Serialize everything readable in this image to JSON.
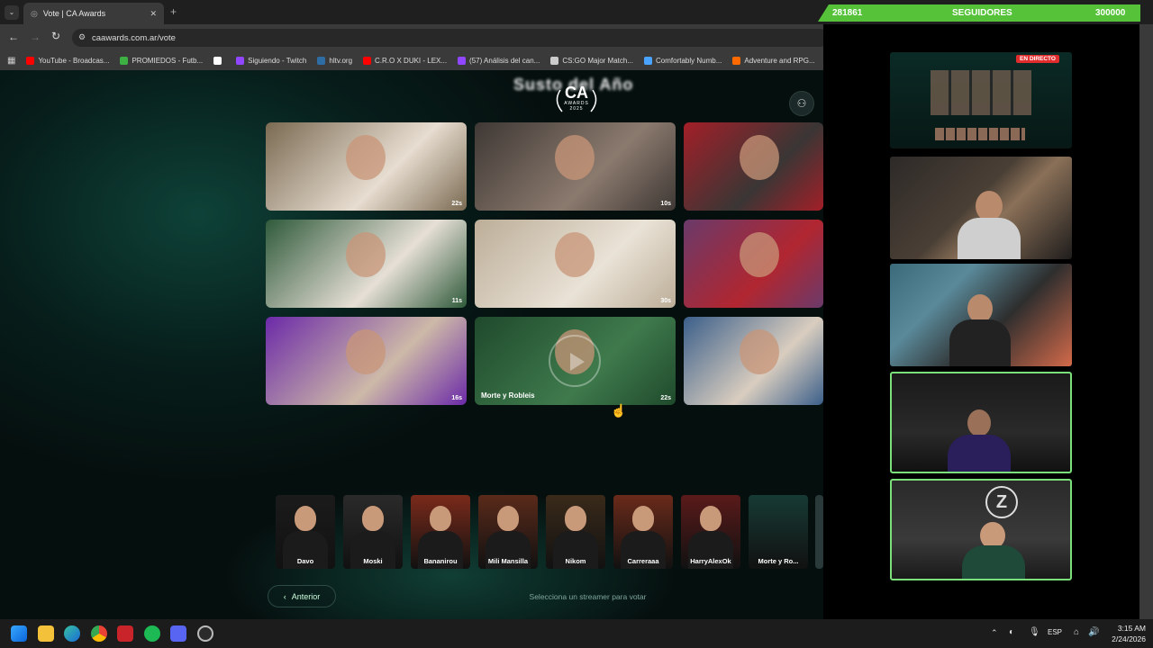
{
  "browser": {
    "tab_title": "Vote | CA Awards",
    "url": "caawards.com.ar/vote",
    "bookmarks": [
      {
        "label": "YouTube - Broadcas...",
        "icon": "youtube-icon",
        "color": "#ff0000"
      },
      {
        "label": "PROMIEDOS - Futb...",
        "icon": "promiedos-icon",
        "color": "#3cb043"
      },
      {
        "label": "",
        "icon": "x-icon",
        "color": "#ffffff"
      },
      {
        "label": "Siguiendo - Twitch",
        "icon": "twitch-icon",
        "color": "#9146ff"
      },
      {
        "label": "hltv.org",
        "icon": "hltv-icon",
        "color": "#2d6da3"
      },
      {
        "label": "C.R.O X DUKI - LEX...",
        "icon": "youtube-icon",
        "color": "#ff0000"
      },
      {
        "label": "(57) Análisis del can...",
        "icon": "twitch-icon",
        "color": "#9146ff"
      },
      {
        "label": "CS:GO Major Match...",
        "icon": "link-icon",
        "color": "#cccccc"
      },
      {
        "label": "Comfortably Numb...",
        "icon": "doc-icon",
        "color": "#4aa3ff"
      },
      {
        "label": "Adventure and RPG...",
        "icon": "game-icon",
        "color": "#ff6a00"
      }
    ]
  },
  "page": {
    "title": "Susto del Año",
    "logo_main": "CA",
    "logo_sub": "AWARDS",
    "logo_year": "2025",
    "clips": [
      {
        "duration": "22s",
        "name": "",
        "color1": "#7a6a52",
        "color2": "#e7ddd0"
      },
      {
        "duration": "10s",
        "name": "",
        "color1": "#3e3834",
        "color2": "#8b7a6e"
      },
      {
        "duration": "",
        "name": "",
        "color1": "#a31f28",
        "color2": "#3a3635"
      },
      {
        "duration": "11s",
        "name": "",
        "color1": "#2f5a3a",
        "color2": "#e6dfd6"
      },
      {
        "duration": "30s",
        "name": "",
        "color1": "#bcae98",
        "color2": "#e9e2d6"
      },
      {
        "duration": "",
        "name": "",
        "color1": "#6a3a6a",
        "color2": "#b12630"
      },
      {
        "duration": "16s",
        "name": "",
        "color1": "#6b2aa8",
        "color2": "#cdb9a8"
      },
      {
        "duration": "22s",
        "name": "Morte y Robleis",
        "color1": "#1f4a2c",
        "color2": "#3f7a4c"
      },
      {
        "duration": "",
        "name": "",
        "color1": "#3b5f8a",
        "color2": "#d9cdbf"
      }
    ],
    "candidates": [
      {
        "name": "Davo"
      },
      {
        "name": "Moski"
      },
      {
        "name": "Bananirou"
      },
      {
        "name": "Mili Mansilla"
      },
      {
        "name": "Nikom"
      },
      {
        "name": "Carreraaa"
      },
      {
        "name": "HarryAlexOk"
      },
      {
        "name": "Morte y Ro..."
      }
    ],
    "prev_label": "Anterior",
    "hint": "Selecciona un streamer para votar"
  },
  "overlay": {
    "follower_count": "281861",
    "follower_label": "SEGUIDORES",
    "follower_goal": "300000",
    "live_badge": "EN DIRECTO",
    "progress_fraction": 0.94
  },
  "taskbar": {
    "time": "3:15 AM",
    "date": "2/24/2026",
    "lang": "ESP"
  }
}
